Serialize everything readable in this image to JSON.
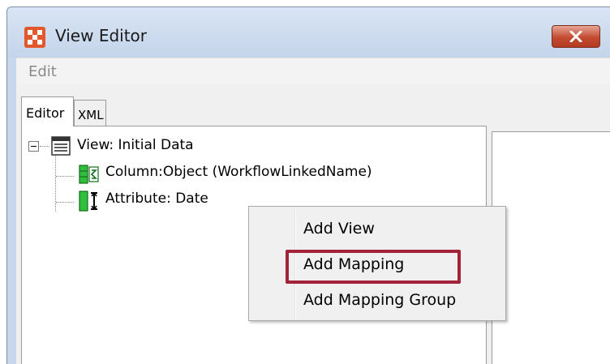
{
  "window": {
    "title": "View Editor"
  },
  "menubar": {
    "edit_label": "Edit"
  },
  "tabs": [
    {
      "label": "Editor",
      "active": true
    },
    {
      "label": "XML",
      "active": false
    }
  ],
  "tree": {
    "root_label": "View: Initial Data",
    "children": [
      {
        "label": "Column:Object (WorkflowLinkedName)",
        "icon": "column-icon"
      },
      {
        "label": "Attribute: Date",
        "icon": "attribute-icon"
      }
    ]
  },
  "context_menu": {
    "items": [
      {
        "label": "Add View"
      },
      {
        "label": "Add Mapping",
        "highlighted": true
      },
      {
        "label": "Add Mapping Group"
      }
    ],
    "highlight_color": "#a1243a"
  },
  "colors": {
    "app_icon": "#e2582c",
    "close_button": "#c44a30"
  }
}
